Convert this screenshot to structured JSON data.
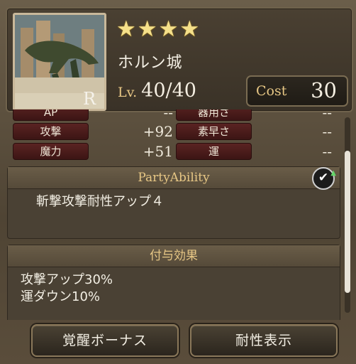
{
  "unit": {
    "stars": 4,
    "name": "ホルン城",
    "level_label": "Lv.",
    "level_value": "40/40",
    "cost_label": "Cost",
    "cost_value": "30",
    "portrait_mark": "R"
  },
  "stats": [
    {
      "label": "AP",
      "value": "--"
    },
    {
      "label": "器用さ",
      "value": "--"
    },
    {
      "label": "攻撃",
      "value": "+92"
    },
    {
      "label": "素早さ",
      "value": "--"
    },
    {
      "label": "魔力",
      "value": "+51"
    },
    {
      "label": "運",
      "value": "--"
    }
  ],
  "party_ability": {
    "title": "PartyAbility",
    "text": "斬撃攻撃耐性アップ４"
  },
  "grant_effect": {
    "title": "付与効果",
    "lines": [
      "攻撃アップ30%",
      "運ダウン10%"
    ]
  },
  "buttons": {
    "awaken": "覚醒ボーナス",
    "resist": "耐性表示"
  },
  "colors": {
    "accent_gold": "#e7c785",
    "stat_label_bg": "#5a2322",
    "scroll_thumb": "#e8e3d8"
  }
}
